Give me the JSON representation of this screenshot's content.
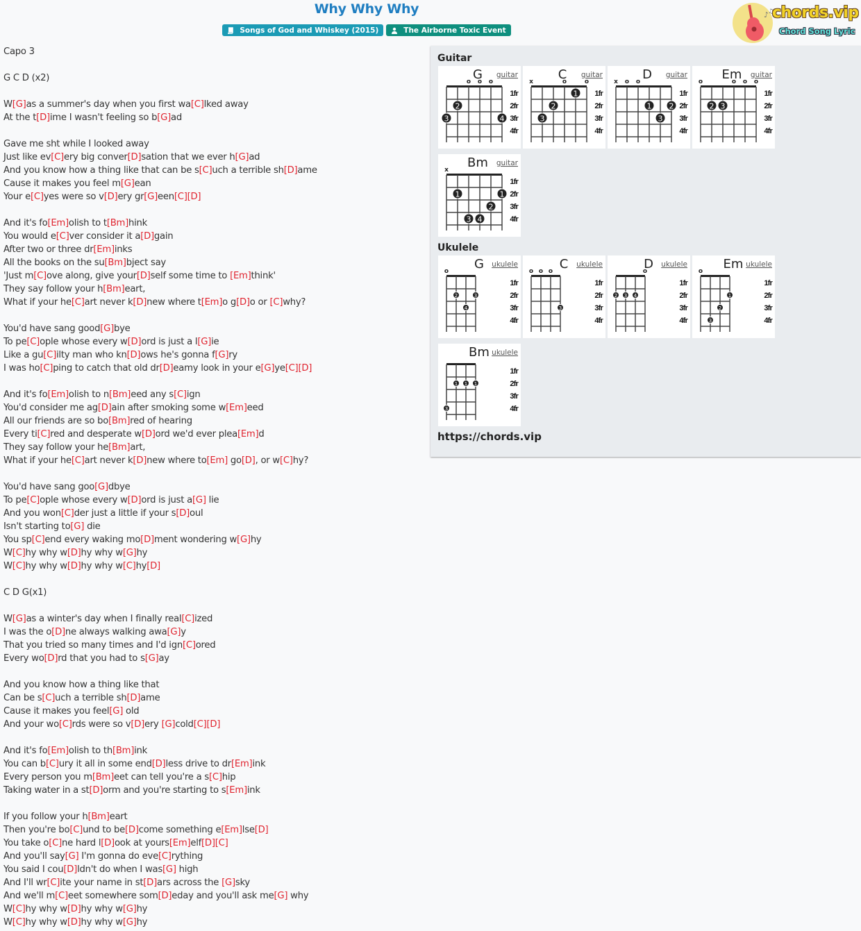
{
  "header": {
    "title": "Why Why Why",
    "album_badge": "Songs of God and Whiskey (2015)",
    "artist_badge": "The Airborne Toxic Event",
    "album_icon": "book-icon",
    "artist_icon": "user-icon"
  },
  "logo": {
    "brand": "chords.vip",
    "tagline": "Chord Song Lyric",
    "icon": "guitar-icon"
  },
  "colors": {
    "title": "#1f7ec1",
    "chord": "#e0242f",
    "album_badge": "#1b9bb5",
    "artist_badge": "#0e8f7e",
    "panel_bg": "#e9ecef"
  },
  "lyrics": [
    "Capo 3",
    "",
    "G C D (x2)",
    "",
    "W[G]as a summer's day when you first wa[C]lked away",
    "At the t[D]ime I wasn't feeling so b[G]ad",
    "",
    "Gave me sht while I looked away",
    "Just like ev[C]ery big conver[D]sation that we ever h[G]ad",
    "And you know how a thing like that can be s[C]uch a terrible sh[D]ame",
    "Cause it makes you feel m[G]ean",
    "Your e[C]yes were so v[D]ery gr[G]een[C][D]",
    "",
    "And it's fo[Em]olish to t[Bm]hink",
    "You would e[C]ver consider it a[D]gain",
    "After two or three dr[Em]inks",
    "All the books on the su[Bm]bject say",
    "'Just m[C]ove along, give your[D]self some time to [Em]think'",
    "They say follow your h[Bm]eart,",
    "What if your he[C]art never k[D]new where t[Em]o g[D]o or [C]why?",
    "",
    "You'd have sang good[G]bye",
    "To pe[C]ople whose every w[D]ord is just a l[G]ie",
    "Like a gu[C]ilty man who kn[D]ows he's gonna f[G]ry",
    "I was ho[C]ping to catch that old dr[D]eamy look in your e[G]ye[C][D]",
    "",
    "And it's fo[Em]olish to n[Bm]eed any s[C]ign",
    "You'd consider me ag[D]ain after smoking some w[Em]eed",
    "All our friends are so bo[Bm]red of hearing",
    "Every ti[C]red and desperate w[D]ord we'd ever plea[Em]d",
    "They say follow your he[Bm]art,",
    "What if your he[C]art never k[D]new where to[Em] go[D], or w[C]hy?",
    "",
    "You'd have sang goo[G]dbye",
    "To pe[C]ople whose every w[D]ord is just a[G] lie",
    "And you won[C]der just a little if your s[D]oul",
    "Isn't starting to[G] die",
    "You sp[C]end every waking mo[D]ment wondering w[G]hy",
    "W[C]hy why w[D]hy why w[G]hy",
    "W[C]hy why w[D]hy why w[C]hy[D]",
    "",
    "C D G(x1)",
    "",
    "W[G]as a winter's day when I finally real[C]ized",
    "I was the o[D]ne always walking awa[G]y",
    "That you tried so many times and I'd ign[C]ored",
    "Every wo[D]rd that you had to s[G]ay",
    "",
    "And you know how a thing like that",
    "Can be s[C]uch a terrible sh[D]ame",
    "Cause it makes you feel[G] old",
    "And your wo[C]rds were so v[D]ery [G]cold[C][D]",
    "",
    "And it's fo[Em]olish to th[Bm]ink",
    "You can b[C]ury it all in some end[D]less drive to dr[Em]ink",
    "Every person you m[Bm]eet can tell you're a s[C]hip",
    "Taking water in a st[D]orm and you're starting to s[Em]ink",
    "",
    "If you follow your h[Bm]eart",
    "Then you're bo[C]und to be[D]come something e[Em]lse[D]",
    "You take o[C]ne hard l[D]ook at yours[Em]elf[D][C]",
    "And you'll say[G] I'm gonna do eve[C]rything",
    "You said I cou[D]ldn't do when I was[G] high",
    "And I'll wr[C]ite your name in st[D]ars across the [G]sky",
    "And we'll m[C]eet somewhere som[D]eday and you'll ask me[G] why",
    "W[C]hy why w[D]hy why w[G]hy",
    "W[C]hy why w[D]hy why w[G]hy"
  ],
  "chord_panel": {
    "guitar_heading": "Guitar",
    "ukulele_heading": "Ukulele",
    "site_url": "https://chords.vip",
    "fret_labels": [
      "1fr",
      "2fr",
      "3fr",
      "4fr"
    ],
    "guitar": [
      {
        "name": "G",
        "link": "guitar",
        "strings": [
          "",
          "",
          "o",
          "o",
          "o",
          ""
        ],
        "dots": [
          {
            "s": 1,
            "f": 2,
            "n": "2"
          },
          {
            "s": 0,
            "f": 3,
            "n": "3"
          },
          {
            "s": 5,
            "f": 3,
            "n": "4"
          }
        ]
      },
      {
        "name": "C",
        "link": "guitar",
        "strings": [
          "x",
          "",
          "",
          "o",
          "",
          "o"
        ],
        "dots": [
          {
            "s": 4,
            "f": 1,
            "n": "1"
          },
          {
            "s": 2,
            "f": 2,
            "n": "2"
          },
          {
            "s": 1,
            "f": 3,
            "n": "3"
          }
        ]
      },
      {
        "name": "D",
        "link": "guitar",
        "strings": [
          "x",
          "o",
          "o",
          "",
          "",
          ""
        ],
        "dots": [
          {
            "s": 3,
            "f": 2,
            "n": "1"
          },
          {
            "s": 5,
            "f": 2,
            "n": "2"
          },
          {
            "s": 4,
            "f": 3,
            "n": "3"
          }
        ]
      },
      {
        "name": "Em",
        "link": "guitar",
        "strings": [
          "o",
          "",
          "",
          "o",
          "o",
          "o"
        ],
        "dots": [
          {
            "s": 1,
            "f": 2,
            "n": "2"
          },
          {
            "s": 2,
            "f": 2,
            "n": "3"
          }
        ]
      },
      {
        "name": "Bm",
        "link": "guitar",
        "strings": [
          "x",
          "",
          "",
          "",
          "",
          ""
        ],
        "dots": [
          {
            "s": 1,
            "f": 2,
            "n": "1"
          },
          {
            "s": 5,
            "f": 2,
            "n": "1"
          },
          {
            "s": 4,
            "f": 3,
            "n": "2"
          },
          {
            "s": 2,
            "f": 4,
            "n": "3"
          },
          {
            "s": 3,
            "f": 4,
            "n": "4"
          }
        ]
      }
    ],
    "ukulele": [
      {
        "name": "G",
        "link": "ukulele",
        "strings": [
          "o",
          "",
          "",
          ""
        ],
        "dots": [
          {
            "s": 1,
            "f": 2,
            "n": "2"
          },
          {
            "s": 3,
            "f": 2,
            "n": "3"
          },
          {
            "s": 2,
            "f": 3,
            "n": "4"
          }
        ]
      },
      {
        "name": "C",
        "link": "ukulele",
        "strings": [
          "o",
          "o",
          "o",
          ""
        ],
        "dots": [
          {
            "s": 3,
            "f": 3,
            "n": "3"
          }
        ]
      },
      {
        "name": "D",
        "link": "ukulele",
        "strings": [
          "",
          "",
          "",
          "o"
        ],
        "dots": [
          {
            "s": 0,
            "f": 2,
            "n": "2"
          },
          {
            "s": 1,
            "f": 2,
            "n": "3"
          },
          {
            "s": 2,
            "f": 2,
            "n": "4"
          }
        ]
      },
      {
        "name": "Em",
        "link": "ukulele",
        "strings": [
          "o",
          "",
          "",
          ""
        ],
        "dots": [
          {
            "s": 3,
            "f": 2,
            "n": "1"
          },
          {
            "s": 2,
            "f": 3,
            "n": "2"
          },
          {
            "s": 1,
            "f": 4,
            "n": "3"
          }
        ]
      },
      {
        "name": "Bm",
        "link": "ukulele",
        "strings": [
          "",
          "",
          "",
          ""
        ],
        "dots": [
          {
            "s": 1,
            "f": 2,
            "n": "1"
          },
          {
            "s": 2,
            "f": 2,
            "n": "1"
          },
          {
            "s": 3,
            "f": 2,
            "n": "1"
          },
          {
            "s": 0,
            "f": 4,
            "n": "3"
          }
        ]
      }
    ]
  }
}
